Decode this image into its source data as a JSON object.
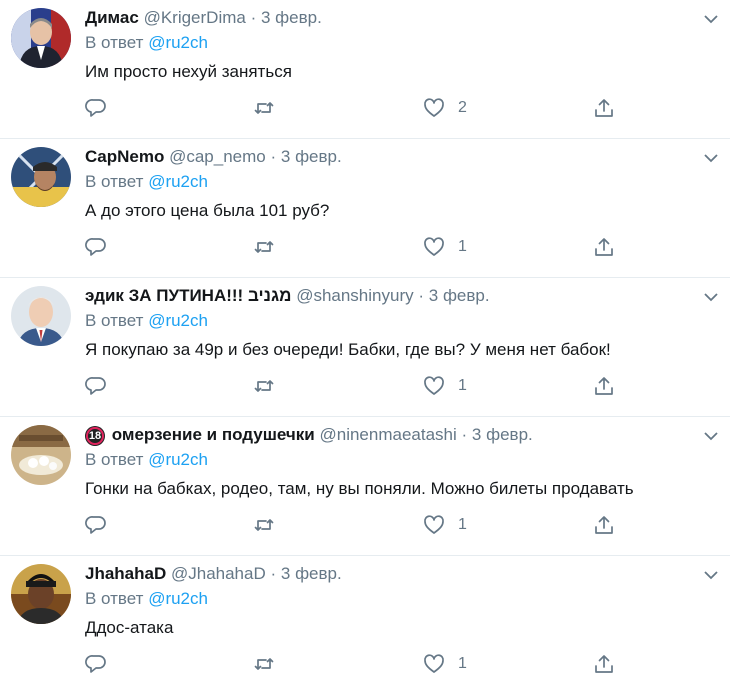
{
  "tweets": [
    {
      "name": "Димас",
      "handle": "@KrigerDima",
      "dot": "·",
      "date": "3 февр.",
      "reply_prefix": "В ответ",
      "reply_to": "@ru2ch",
      "text": "Им просто нехуй заняться",
      "likes": "2"
    },
    {
      "name": "CapNemo",
      "handle": "@cap_nemo",
      "dot": "·",
      "date": "3 февр.",
      "reply_prefix": "В ответ",
      "reply_to": "@ru2ch",
      "text": "А до этого цена была 101 руб?",
      "likes": "1"
    },
    {
      "name": "эдик ЗА ПУТИНА!!! מגניב",
      "handle": "@shanshinyury",
      "dot": "·",
      "date": "3 февр.",
      "reply_prefix": "В ответ",
      "reply_to": "@ru2ch",
      "text": "Я покупаю за 49р и без очереди! Бабки, где вы? У меня нет бабок!",
      "likes": "1"
    },
    {
      "badge": "18",
      "name": "омерзение и подушечки",
      "handle": "@ninenmaeatashi",
      "dot": "·",
      "date": "3 февр.",
      "reply_prefix": "В ответ",
      "reply_to": "@ru2ch",
      "text": "Гонки на бабках, родео, там, ну вы поняли. Можно билеты продавать",
      "likes": "1"
    },
    {
      "name": "JhahahaD",
      "handle": "@JhahahaD",
      "dot": "·",
      "date": "3 февр.",
      "reply_prefix": "В ответ",
      "reply_to": "@ru2ch",
      "text": "Ддос-атака",
      "likes": "1"
    }
  ],
  "icons": {
    "reply": "reply-icon",
    "retweet": "retweet-icon",
    "like": "heart-icon",
    "share": "share-icon",
    "menu": "chevron-down-icon"
  },
  "colors": {
    "accent": "#1da1f2",
    "muted": "#657786",
    "text": "#14171a",
    "divider": "#e6ecf0"
  }
}
